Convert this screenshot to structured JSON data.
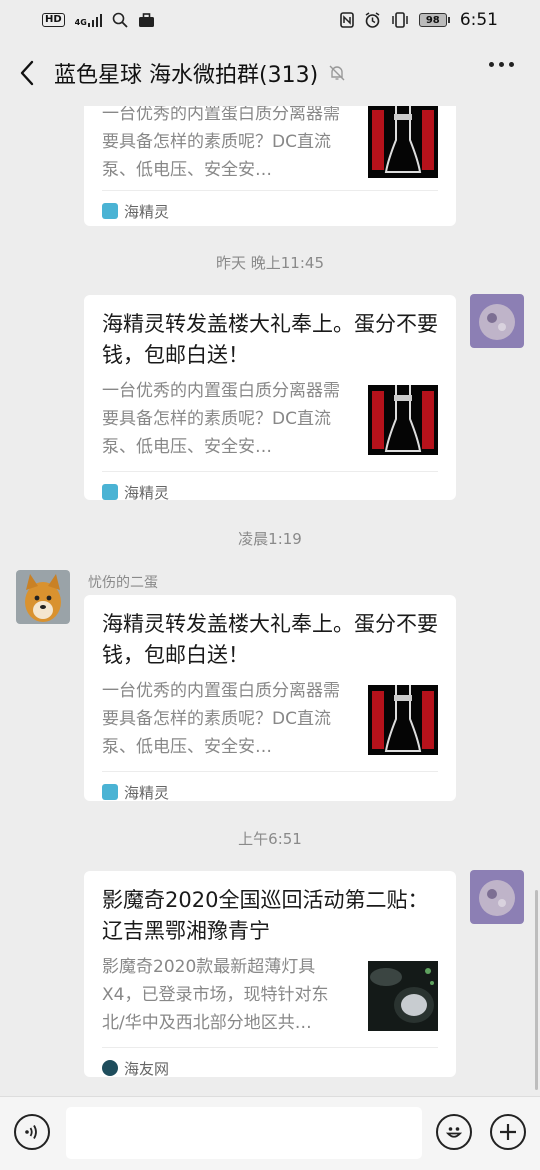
{
  "statusbar": {
    "time": "6:51",
    "battery": "98",
    "network": "4G",
    "hd": "HD"
  },
  "header": {
    "title": "蓝色星球 海水微拍群(313)"
  },
  "messages": [
    {
      "title": "",
      "desc": "一台优秀的内置蛋白质分离器需要具备怎样的素质呢？DC直流泵、低电压、安全安…",
      "source": "海精灵"
    },
    {
      "time": "昨天 晚上11:45",
      "title": "海精灵转发盖楼大礼奉上。蛋分不要钱，包邮白送！",
      "desc": "一台优秀的内置蛋白质分离器需要具备怎样的素质呢？DC直流泵、低电压、安全安…",
      "source": "海精灵"
    },
    {
      "time": "凌晨1:19",
      "nickname": "忧伤的二蛋",
      "title": "海精灵转发盖楼大礼奉上。蛋分不要钱，包邮白送！",
      "desc": "一台优秀的内置蛋白质分离器需要具备怎样的素质呢？DC直流泵、低电压、安全安…",
      "source": "海精灵"
    },
    {
      "time": "上午6:51",
      "title": "影魔奇2020全国巡回活动第二贴： 辽吉黑鄂湘豫青宁",
      "desc": "影魔奇2020款最新超薄灯具X4，已登录市场，现特针对东北/华中及西北部分地区共…",
      "source": "海友网"
    }
  ],
  "colors": {
    "background": "#ededed",
    "card": "#ffffff",
    "meta_text": "#8a8a8a"
  },
  "icons": [
    "back-arrow-icon",
    "mute-bell-icon",
    "more-icon",
    "voice-icon",
    "emoji-icon",
    "plus-icon",
    "nfc-icon",
    "alarm-icon",
    "vibrate-icon"
  ]
}
